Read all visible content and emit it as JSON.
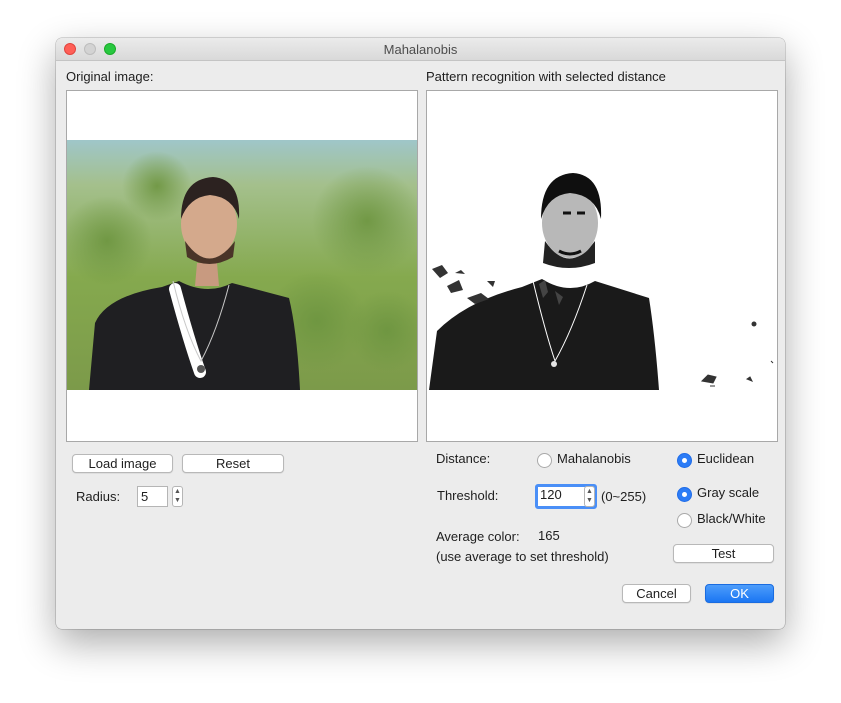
{
  "window": {
    "title": "Mahalanobis"
  },
  "left": {
    "heading": "Original image:",
    "load_button": "Load image",
    "reset_button": "Reset",
    "radius_label": "Radius:",
    "radius_value": "5"
  },
  "right": {
    "heading": "Pattern recognition with selected distance",
    "distance_label": "Distance:",
    "distance_options": {
      "mahalanobis": "Mahalanobis",
      "euclidean": "Euclidean"
    },
    "distance_selected": "Euclidean",
    "threshold_label": "Threshold:",
    "threshold_value": "120",
    "threshold_range": "(0~255)",
    "mode_options": {
      "gray": "Gray scale",
      "bw": "Black/White"
    },
    "mode_selected": "Gray scale",
    "average_label": "Average color:",
    "average_value": "165",
    "average_hint": "(use average to set threshold)",
    "test_button": "Test"
  },
  "footer": {
    "cancel_button": "Cancel",
    "ok_button": "OK"
  },
  "colors": {
    "accent": "#2c7cf6",
    "ok_button": "#1b76f3",
    "focus_ring": "#4a8ff7"
  },
  "icons": [
    "close-window",
    "minimize-window",
    "zoom-window",
    "stepper-arrows"
  ]
}
